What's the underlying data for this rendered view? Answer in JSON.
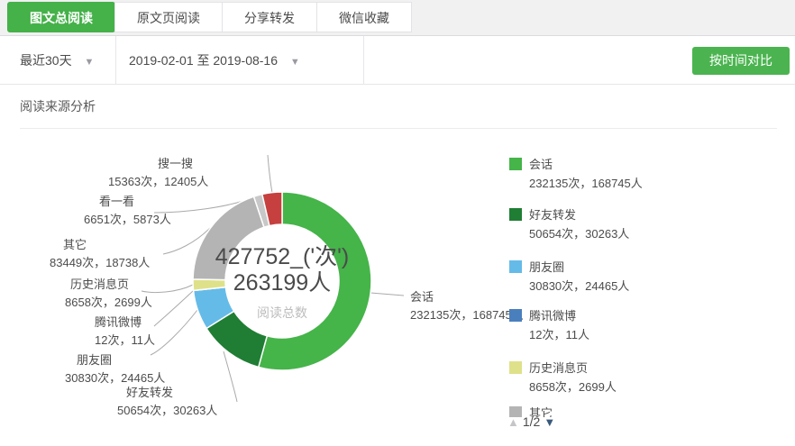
{
  "tabs": [
    {
      "label": "图文总阅读",
      "active": true
    },
    {
      "label": "原文页阅读",
      "active": false
    },
    {
      "label": "分享转发",
      "active": false
    },
    {
      "label": "微信收藏",
      "active": false
    }
  ],
  "filters": {
    "range_label": "最近30天",
    "date_range": "2019-02-01 至 2019-08-16",
    "compare_button": "按时间对比"
  },
  "section": {
    "title": "阅读来源分析"
  },
  "chart_data": {
    "type": "pie",
    "title": "阅读来源分析",
    "center_line1": "427752_('次')",
    "center_line2": "263199人",
    "center_caption": "阅读总数",
    "total_reads": 427752,
    "total_readers": 263199,
    "donut": {
      "outer_radius": 99,
      "inner_radius": 63,
      "start": "top",
      "direction": "clockwise"
    },
    "series": [
      {
        "name": "会话",
        "reads": 232135,
        "readers": 168745,
        "display": "232135次，168745人",
        "color": "#45b449"
      },
      {
        "name": "好友转发",
        "reads": 50654,
        "readers": 30263,
        "display": "50654次，30263人",
        "color": "#1f7e34"
      },
      {
        "name": "朋友圈",
        "reads": 30830,
        "readers": 24465,
        "display": "30830次，24465人",
        "color": "#65bbe8"
      },
      {
        "name": "腾讯微博",
        "reads": 12,
        "readers": 11,
        "display": "12次，11人",
        "color": "#4a7fbd"
      },
      {
        "name": "历史消息页",
        "reads": 8658,
        "readers": 2699,
        "display": "8658次，2699人",
        "color": "#dfe18a"
      },
      {
        "name": "其它",
        "reads": 83449,
        "readers": 18738,
        "display": "83449次，18738人",
        "color": "#b4b4b4"
      },
      {
        "name": "看一看",
        "reads": 6651,
        "readers": 5873,
        "display": "6651次，5873人",
        "color": "#c8c8c8"
      },
      {
        "name": "搜一搜",
        "reads": 15363,
        "readers": 12405,
        "display": "15363次，12405人",
        "color": "#c5403e"
      }
    ],
    "legend_position": "right",
    "legend_page": "1/2"
  }
}
